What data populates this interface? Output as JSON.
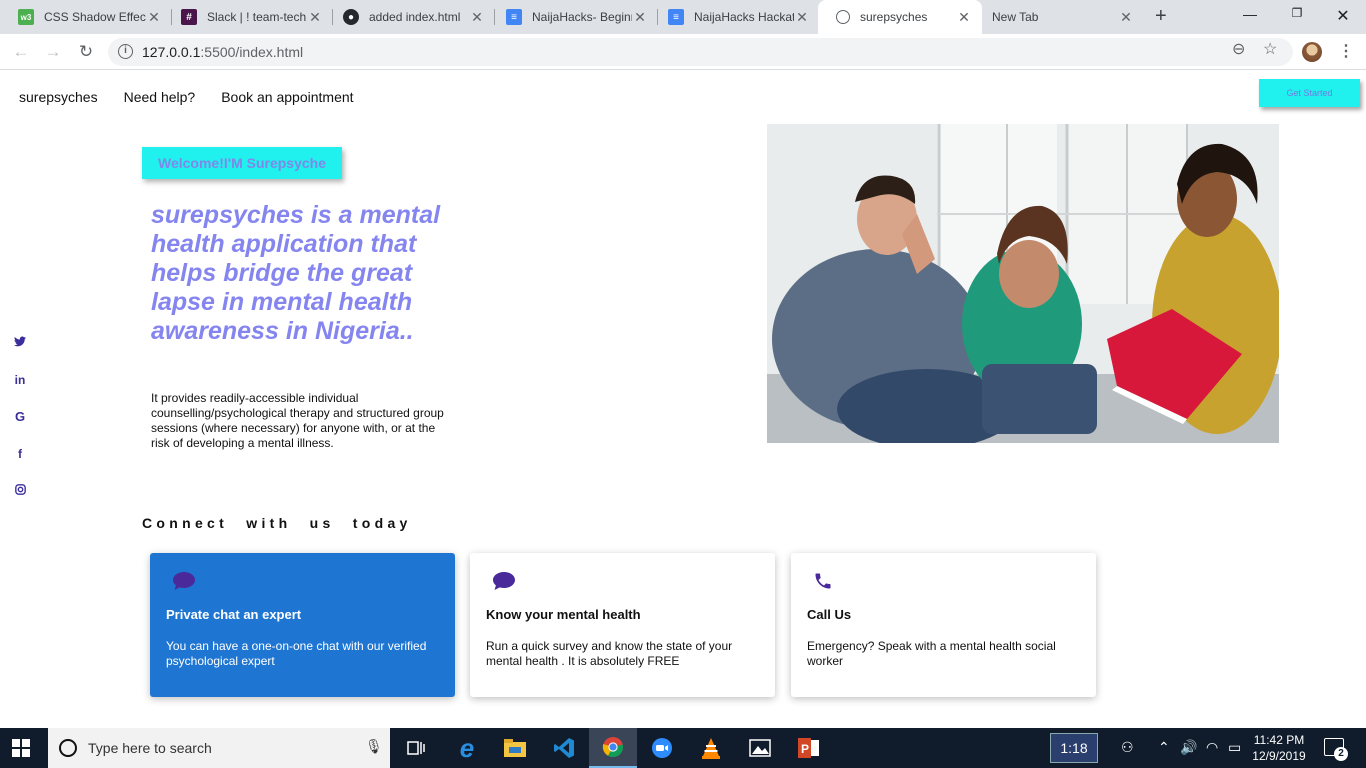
{
  "browser": {
    "tabs": [
      {
        "title": "CSS Shadow Effect",
        "icon": "w3schools-icon",
        "color": "#4caf50",
        "glyph": "w3"
      },
      {
        "title": "Slack | ! team-tech",
        "icon": "slack-icon",
        "color": "#4a154b",
        "glyph": "#"
      },
      {
        "title": "added index.html",
        "icon": "github-icon",
        "color": "#24292e",
        "glyph": "●"
      },
      {
        "title": "NaijaHacks- Beginn",
        "icon": "google-docs-icon",
        "color": "#4285f4",
        "glyph": "≡"
      },
      {
        "title": "NaijaHacks Hackat",
        "icon": "google-docs-icon",
        "color": "#4285f4",
        "glyph": "≡"
      },
      {
        "title": "surepsyches",
        "icon": "globe-icon",
        "color": "#5f6368",
        "glyph": "◍"
      },
      {
        "title": "New Tab",
        "icon": "",
        "color": "",
        "glyph": ""
      }
    ],
    "active_tab_index": 5,
    "url_host": "127.0.0.1",
    "url_path": ":5500/index.html"
  },
  "site": {
    "nav": [
      "surepsyches",
      "Need help?",
      "Book an appointment"
    ],
    "get_started": "Get Started",
    "welcome": "Welcome!I'M Surepsyche",
    "headline": "surepsyches is a mental health application that helps bridge the great lapse in mental health awareness in Nigeria..",
    "description": "It provides readily-accessible individual counselling/psychological therapy and structured group sessions (where necessary) for anyone with, or at the risk of developing a mental illness.",
    "socials": [
      {
        "name": "twitter-icon",
        "glyph": "🐦"
      },
      {
        "name": "linkedin-icon",
        "glyph": "in"
      },
      {
        "name": "google-icon",
        "glyph": "G"
      },
      {
        "name": "facebook-icon",
        "glyph": "f"
      },
      {
        "name": "instagram-icon",
        "glyph": "◎"
      }
    ],
    "connect_heading": "Connect with us today",
    "cards": [
      {
        "title": "Private chat an expert",
        "text": "You can have a one-on-one chat with our verified psychological expert",
        "icon": "chat-bubble-icon"
      },
      {
        "title": "Know your mental health",
        "text": "Run a quick survey and know the state of your mental health . It is absolutely FREE",
        "icon": "chat-bubble-icon"
      },
      {
        "title": "Call Us",
        "text": "Emergency? Speak with a mental health social worker",
        "icon": "phone-icon"
      }
    ],
    "colors": {
      "accent_cyan": "#20f0ee",
      "headline_purple": "#8585f0",
      "card_blue": "#1f76d2",
      "icon_purple": "#4a2a9a"
    }
  },
  "taskbar": {
    "search_placeholder": "Type here to search",
    "timer": "1:18",
    "time": "11:42 PM",
    "date": "12/9/2019",
    "notifications": "2",
    "apps": [
      "task-view-icon",
      "edge-icon",
      "file-explorer-icon",
      "vscode-icon",
      "chrome-icon",
      "zoom-icon",
      "vlc-icon",
      "photos-icon",
      "powerpoint-icon"
    ]
  }
}
